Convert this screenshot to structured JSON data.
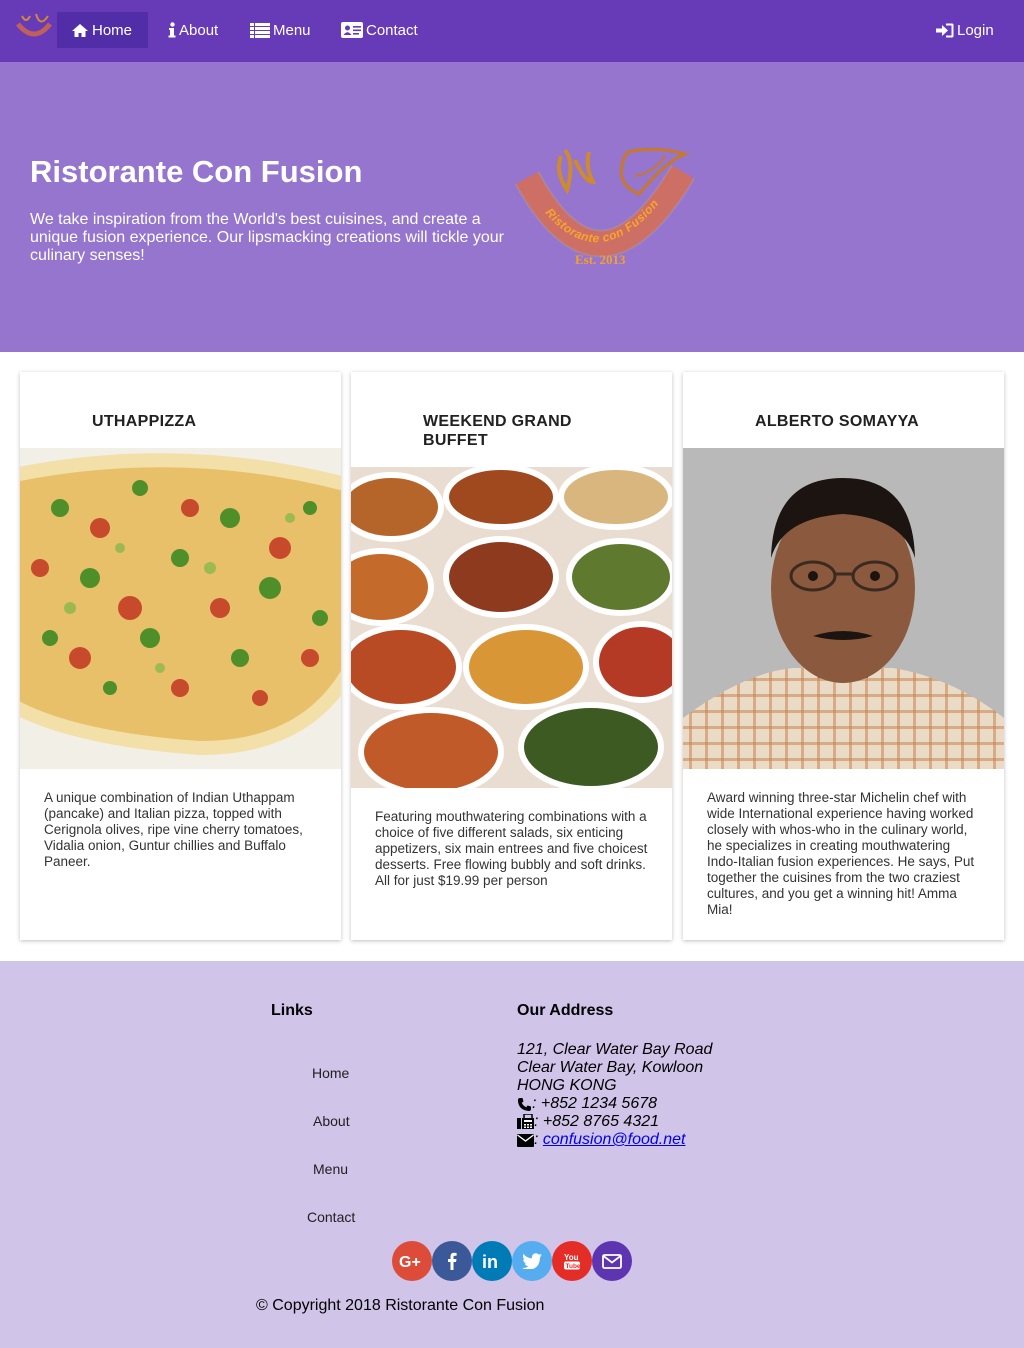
{
  "navbar": {
    "brand_logo": "ristorante-logo-small",
    "items": [
      {
        "label": "Home",
        "icon": "home-icon"
      },
      {
        "label": "About",
        "icon": "info-icon"
      },
      {
        "label": "Menu",
        "icon": "list-icon"
      },
      {
        "label": "Contact",
        "icon": "address-card-icon"
      }
    ],
    "login": {
      "label": "Login",
      "icon": "sign-in-icon"
    }
  },
  "jumbotron": {
    "title": "Ristorante Con Fusion",
    "text": "We take inspiration from the World's best cuisines, and create a unique fusion experience. Our lipsmacking creations will tickle your culinary senses!",
    "logo": {
      "arc_text": "Ristorante con Fusion",
      "est": "Est. 2013"
    }
  },
  "cards": [
    {
      "title": "UTHAPPIZZA",
      "image": "pizza-photo",
      "text": "A unique combination of Indian Uthappam (pancake) and Italian pizza, topped with Cerignola olives, ripe vine cherry tomatoes, Vidalia onion, Guntur chillies and Buffalo Paneer."
    },
    {
      "title": "WEEKEND GRAND BUFFET",
      "image": "buffet-photo",
      "text": "Featuring mouthwatering combinations with a choice of five different salads, six enticing appetizers, six main entrees and five choicest desserts. Free flowing bubbly and soft drinks. All for just $19.99 per person"
    },
    {
      "title": "ALBERTO SOMAYYA",
      "image": "chef-portrait-photo",
      "text": "Award winning three-star Michelin chef with wide International experience having worked closely with whos-who in the culinary world, he specializes in creating mouthwatering Indo-Italian fusion experiences. He says, Put together the cuisines from the two craziest cultures, and you get a winning hit! Amma Mia!"
    }
  ],
  "footer": {
    "links_heading": "Links",
    "links": [
      "Home",
      "About",
      "Menu",
      "Contact"
    ],
    "address_heading": "Our Address",
    "address_lines": [
      "121, Clear Water Bay Road",
      "Clear Water Bay, Kowloon",
      "HONG KONG"
    ],
    "phone": ": +852 1234 5678",
    "fax": ": +852 8765 4321",
    "email_prefix": ": ",
    "email": "confusion@food.net",
    "social": [
      {
        "name": "google-plus-icon",
        "color": "#dd4b39"
      },
      {
        "name": "facebook-icon",
        "color": "#3b5998"
      },
      {
        "name": "linkedin-icon",
        "color": "#007bb6"
      },
      {
        "name": "twitter-icon",
        "color": "#55acee"
      },
      {
        "name": "youtube-icon",
        "color": "#e52d27"
      },
      {
        "name": "mail-icon",
        "color": "#5e35b1"
      }
    ],
    "copyright": "© Copyright 2018 Ristorante Con Fusion"
  },
  "colors": {
    "navbar": "#673ab7",
    "navbar_active": "#512da8",
    "jumbotron": "#9575cd",
    "footer": "#d1c4e9"
  }
}
